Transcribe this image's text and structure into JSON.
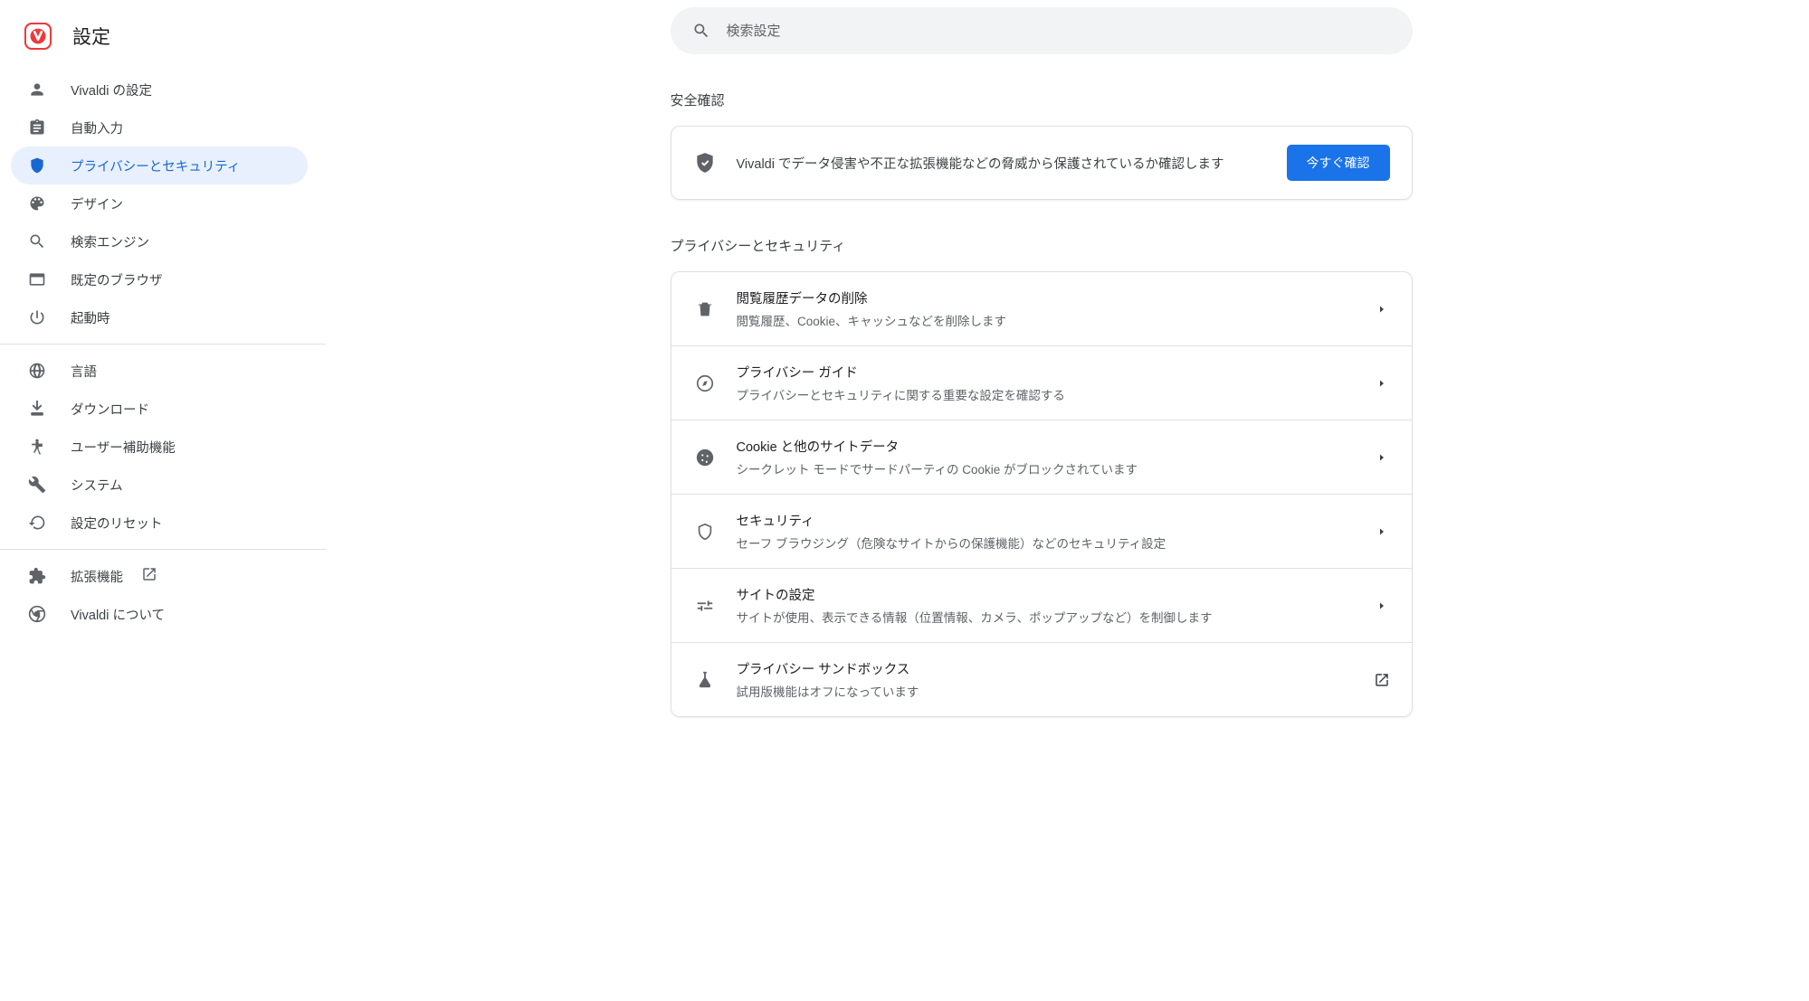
{
  "header": {
    "title": "設定"
  },
  "search": {
    "placeholder": "検索設定"
  },
  "sidebar": {
    "group1": [
      {
        "id": "vivaldi-settings",
        "label": "Vivaldi の設定"
      },
      {
        "id": "autofill",
        "label": "自動入力"
      },
      {
        "id": "privacy",
        "label": "プライバシーとセキュリティ"
      },
      {
        "id": "design",
        "label": "デザイン"
      },
      {
        "id": "search-engine",
        "label": "検索エンジン"
      },
      {
        "id": "default-browser",
        "label": "既定のブラウザ"
      },
      {
        "id": "startup",
        "label": "起動時"
      }
    ],
    "group2": [
      {
        "id": "language",
        "label": "言語"
      },
      {
        "id": "download",
        "label": "ダウンロード"
      },
      {
        "id": "accessibility",
        "label": "ユーザー補助機能"
      },
      {
        "id": "system",
        "label": "システム"
      },
      {
        "id": "reset",
        "label": "設定のリセット"
      }
    ],
    "group3": [
      {
        "id": "extensions",
        "label": "拡張機能"
      },
      {
        "id": "about-vivaldi",
        "label": "Vivaldi について"
      }
    ]
  },
  "safety": {
    "header": "安全確認",
    "text": "Vivaldi でデータ侵害や不正な拡張機能などの脅威から保護されているか確認します",
    "button": "今すぐ確認"
  },
  "privacy": {
    "header": "プライバシーとセキュリティ",
    "rows": [
      {
        "id": "clear-data",
        "title": "閲覧履歴データの削除",
        "sub": "閲覧履歴、Cookie、キャッシュなどを削除します"
      },
      {
        "id": "privacy-guide",
        "title": "プライバシー ガイド",
        "sub": "プライバシーとセキュリティに関する重要な設定を確認する"
      },
      {
        "id": "cookies",
        "title": "Cookie と他のサイトデータ",
        "sub": "シークレット モードでサードパーティの Cookie がブロックされています"
      },
      {
        "id": "security",
        "title": "セキュリティ",
        "sub": "セーフ ブラウジング（危険なサイトからの保護機能）などのセキュリティ設定"
      },
      {
        "id": "site-settings",
        "title": "サイトの設定",
        "sub": "サイトが使用、表示できる情報（位置情報、カメラ、ポップアップなど）を制御します"
      },
      {
        "id": "privacy-sandbox",
        "title": "プライバシー サンドボックス",
        "sub": "試用版機能はオフになっています"
      }
    ]
  }
}
